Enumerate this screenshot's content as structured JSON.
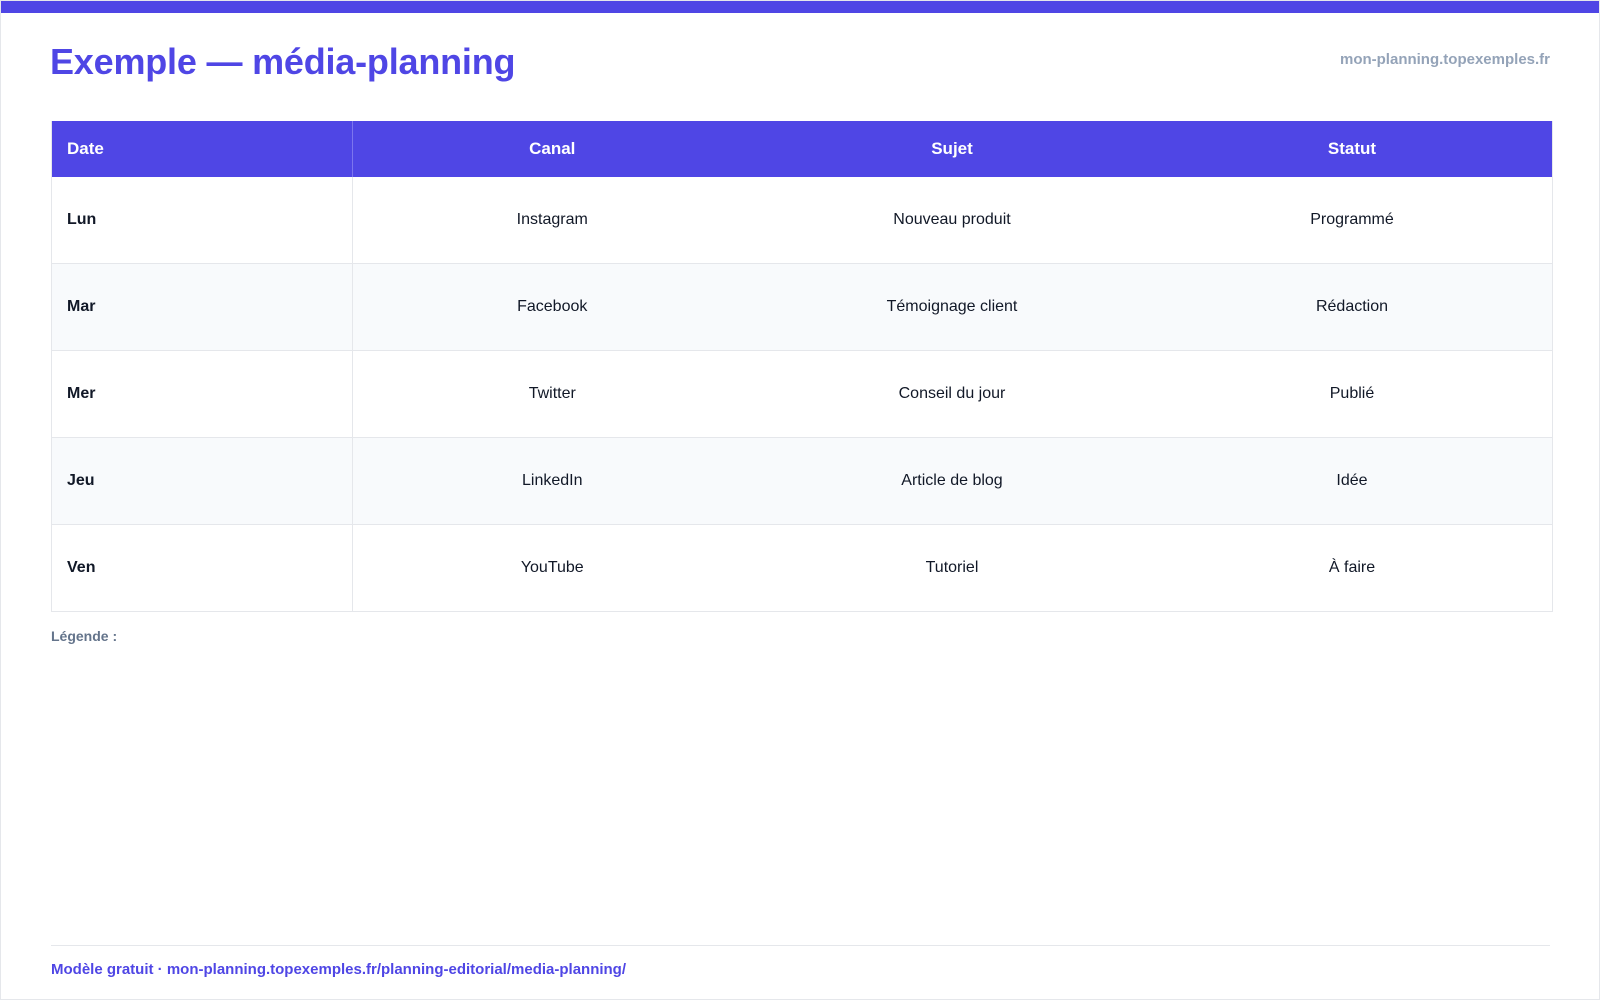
{
  "header": {
    "title": "Exemple — média-planning",
    "domain": "mon-planning.topexemples.fr"
  },
  "table": {
    "columns": [
      "Date",
      "Canal",
      "Sujet",
      "Statut"
    ],
    "rows": [
      [
        "Lun",
        "Instagram",
        "Nouveau produit",
        "Programmé"
      ],
      [
        "Mar",
        "Facebook",
        "Témoignage client",
        "Rédaction"
      ],
      [
        "Mer",
        "Twitter",
        "Conseil du jour",
        "Publié"
      ],
      [
        "Jeu",
        "LinkedIn",
        "Article de blog",
        "Idée"
      ],
      [
        "Ven",
        "YouTube",
        "Tutoriel",
        "À faire"
      ]
    ]
  },
  "legend": {
    "label": "Légende :"
  },
  "footer": {
    "text": "Modèle gratuit · mon-planning.topexemples.fr/planning-editorial/media-planning/"
  },
  "colors": {
    "accent": "#4f46e5",
    "muted": "#94a3b8",
    "row_alt": "#f8fafc"
  }
}
